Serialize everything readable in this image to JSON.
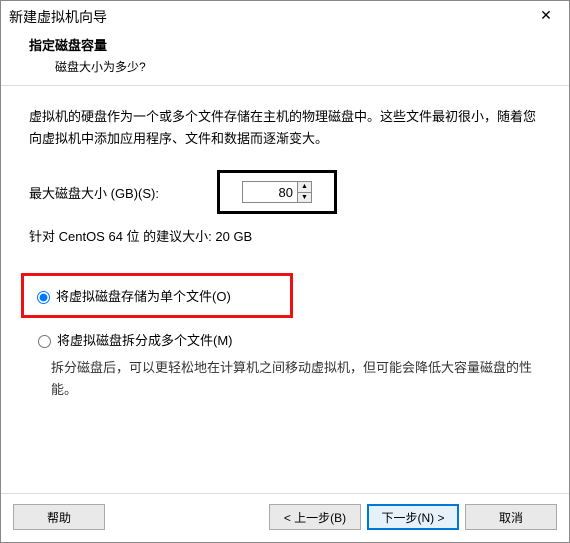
{
  "titlebar": {
    "title": "新建虚拟机向导"
  },
  "header": {
    "title": "指定磁盘容量",
    "subtitle": "磁盘大小为多少?"
  },
  "intro": "虚拟机的硬盘作为一个或多个文件存储在主机的物理磁盘中。这些文件最初很小，随着您向虚拟机中添加应用程序、文件和数据而逐渐变大。",
  "disk": {
    "size_label": "最大磁盘大小 (GB)(S):",
    "size_value": "80",
    "recommend": "针对 CentOS 64 位 的建议大小: 20 GB"
  },
  "options": {
    "single_label": "将虚拟磁盘存储为单个文件(O)",
    "split_label": "将虚拟磁盘拆分成多个文件(M)",
    "split_desc": "拆分磁盘后，可以更轻松地在计算机之间移动虚拟机，但可能会降低大容量磁盘的性能。"
  },
  "buttons": {
    "help": "帮助",
    "back": "< 上一步(B)",
    "next": "下一步(N) >",
    "cancel": "取消"
  }
}
